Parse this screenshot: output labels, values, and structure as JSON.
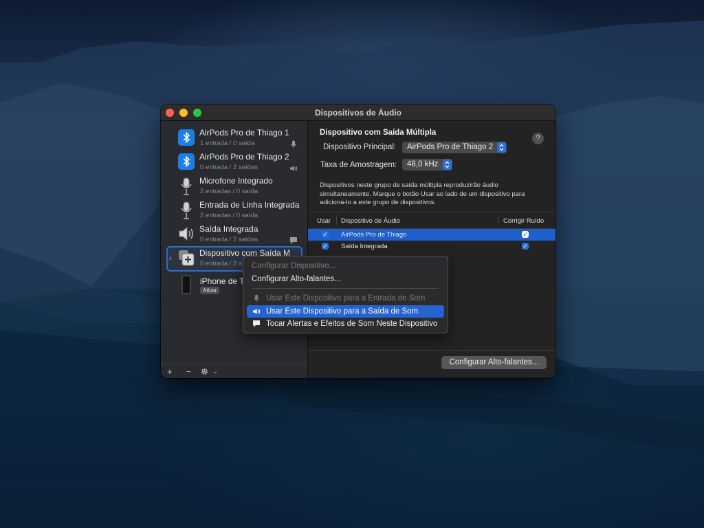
{
  "window": {
    "title": "Dispositivos de Áudio"
  },
  "sidebar": {
    "devices": [
      {
        "name": "AirPods Pro de Thiago 1",
        "sub": "1 entrada / 0 saída",
        "icon": "bluetooth-icon",
        "right_icon": "microphone-icon"
      },
      {
        "name": "AirPods Pro de Thiago 2",
        "sub": "0 entrada / 2 saídas",
        "icon": "bluetooth-icon",
        "right_icon": "speaker-icon"
      },
      {
        "name": "Microfone Integrado",
        "sub": "2 entradas / 0 saída",
        "icon": "microphone-icon"
      },
      {
        "name": "Entrada de Linha Integrada",
        "sub": "2 entradas / 0 saída",
        "icon": "microphone-icon"
      },
      {
        "name": "Saída Integrada",
        "sub": "0 entrada / 2 saídas",
        "icon": "speaker-icon",
        "right_icon": "alert-icon"
      },
      {
        "name": "Dispositivo com Saída M",
        "sub": "0 entrada / 2 s",
        "icon": "multi-output-icon",
        "selected": true
      },
      {
        "name": "iPhone de T",
        "badge": "Ativar",
        "icon": "iphone-icon"
      }
    ],
    "bottom": {
      "add": "+",
      "remove": "−",
      "gear": "gear-icon",
      "chevron": "chevron-down-icon"
    }
  },
  "main": {
    "heading": "Dispositivo com Saída Múltipla",
    "help": "?",
    "primary_label": "Dispositivo Principal:",
    "primary_value": "AirPods Pro de Thiago 2",
    "rate_label": "Taxa de Amostragem:",
    "rate_value": "48,0 kHz",
    "description": "Dispositivos neste grupo de saída múltipla reproduzirão áudio simultaneamente. Marque o botão Usar ao lado de um dispositivo para adicioná-lo a este grupo de dispositivos.",
    "table": {
      "headers": [
        "Usar",
        "Dispositivo de Áudio",
        "Corrigir Ruído"
      ],
      "rows": [
        {
          "use": true,
          "device": "AirPods Pro de Thiago",
          "drift": true,
          "selected": true
        },
        {
          "use": true,
          "device": "Saída Integrada",
          "drift": true,
          "selected": false
        }
      ]
    },
    "configure_speakers_button": "Configurar Alto-falantes..."
  },
  "context_menu": {
    "items": [
      {
        "label": "Configurar Dispositivo...",
        "enabled": false
      },
      {
        "label": "Configurar Alto-falantes...",
        "enabled": true
      },
      {
        "label": "Usar Este Dispositivo para a Entrada de Som",
        "enabled": false,
        "icon": "microphone-icon"
      },
      {
        "label": "Usar Este Dispositivo para a Saída de Som",
        "enabled": true,
        "icon": "speaker-icon",
        "highlighted": true
      },
      {
        "label": "Tocar Alertas e Efeitos de Som Neste Dispositivo",
        "enabled": true,
        "icon": "alert-icon"
      }
    ]
  },
  "colors": {
    "accent": "#2564cf",
    "window_bg": "#1e1e1e",
    "sidebar_bg": "#2a2b2e"
  }
}
